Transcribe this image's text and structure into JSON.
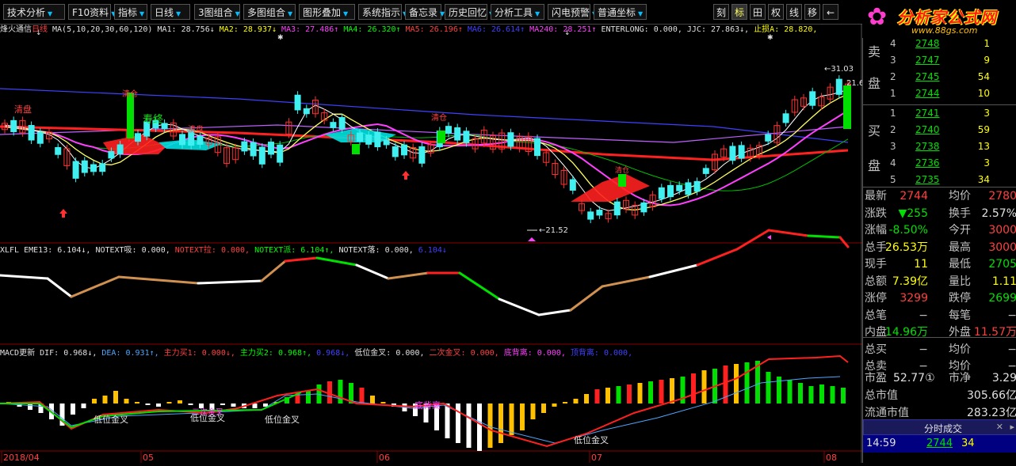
{
  "toolbar": {
    "items": [
      "技术分析",
      "F10资料",
      "指标",
      "日线",
      "3图组合",
      "多图组合",
      "图形叠加",
      "系统指示",
      "备忘录",
      "历史回忆",
      "分析工具",
      "闪电预警",
      "普通坐标"
    ],
    "right": [
      "刻",
      "标",
      "田",
      "权",
      "线",
      "移",
      "←"
    ],
    "dropdown_icon": "triangle-down-icon"
  },
  "logo": {
    "title": "分析家公式网",
    "url": "www.88gs.com",
    "icon": "flower-icon"
  },
  "main_panel": {
    "name": "烽火通信",
    "period": "日线",
    "ma_label": "MA(5,10,20,30,60,120)",
    "items": [
      {
        "k": "MA1:",
        "v": "28.756↓",
        "color": "#e0e0e0"
      },
      {
        "k": "MA2:",
        "v": "28.937↓",
        "color": "#ffff00"
      },
      {
        "k": "MA3:",
        "v": "27.486↑",
        "color": "#ff40ff"
      },
      {
        "k": "MA4:",
        "v": "26.320↑",
        "color": "#00ff00"
      },
      {
        "k": "MA5:",
        "v": "26.196↑",
        "color": "#ff4040"
      },
      {
        "k": "MA6:",
        "v": "26.614↑",
        "color": "#4040ff"
      },
      {
        "k": "MA240:",
        "v": "28.251↑",
        "color": "#ff40ff"
      },
      {
        "k": "ENTERLONG:",
        "v": "0.000,",
        "color": "#e0e0e0"
      },
      {
        "k": "JJC:",
        "v": "27.863↓,",
        "color": "#e0e0e0"
      },
      {
        "k": "止损A:",
        "v": "28.820,",
        "color": "#ffff00"
      }
    ],
    "annotations": {
      "qingpan1": "清盘",
      "qingpan2": "清盘",
      "shouzhong": "寿终",
      "qingcang1": "清仓",
      "qingcang2": "清仓",
      "qingcang3": "清仓",
      "low": "21.52",
      "high": "31.03",
      "last": "21.6"
    }
  },
  "xlfl_panel": {
    "label": "XLFL EME13:",
    "items": [
      {
        "k": "EME13:",
        "v": "6.104↓,",
        "color": "#e0e0e0"
      },
      {
        "k": "NOTEXT吸:",
        "v": "0.000,",
        "color": "#e0e0e0"
      },
      {
        "k": "NOTEXT拉:",
        "v": "0.000,",
        "color": "#ff4040"
      },
      {
        "k": "NOTEXT派:",
        "v": "6.104↑,",
        "color": "#00ff00"
      },
      {
        "k": "NOTEXT落:",
        "v": "0.000,",
        "color": "#e0e0e0"
      },
      {
        "k": "",
        "v": "6.104↓",
        "color": "#4040ff"
      }
    ]
  },
  "macd_panel": {
    "label": "MACD更新",
    "items": [
      {
        "k": "DIF:",
        "v": "0.968↓,",
        "color": "#e0e0e0"
      },
      {
        "k": "DEA:",
        "v": "0.931↑,",
        "color": "#4da6ff"
      },
      {
        "k": "主力买1:",
        "v": "0.000↓,",
        "color": "#ff4040"
      },
      {
        "k": "主力买2:",
        "v": "0.968↑,",
        "color": "#00ff00"
      },
      {
        "k": "",
        "v": "0.968↓,",
        "color": "#4040ff"
      },
      {
        "k": "低位金叉:",
        "v": "0.000,",
        "color": "#e0e0e0"
      },
      {
        "k": "二次金叉:",
        "v": "0.000,",
        "color": "#ff4040"
      },
      {
        "k": "底背离:",
        "v": "0.000,",
        "color": "#ff40ff"
      },
      {
        "k": "顶背离:",
        "v": "0.000,",
        "color": "#4040ff"
      }
    ],
    "annotations": {
      "jx1": "低位金叉",
      "jx2": "低位金叉",
      "jx3": "低位金叉",
      "jx4": "低位金叉",
      "ecjx": "二次金叉",
      "dbl": "底背离"
    }
  },
  "xaxis": {
    "labels": [
      "2018/04",
      "05",
      "06",
      "07",
      "08"
    ]
  },
  "orderbook": {
    "sell_label": [
      "卖",
      "盘"
    ],
    "buy_label": [
      "买",
      "盘"
    ],
    "sells": [
      {
        "lvl": "4",
        "price": "2748",
        "vol": "1"
      },
      {
        "lvl": "3",
        "price": "2747",
        "vol": "9"
      },
      {
        "lvl": "2",
        "price": "2745",
        "vol": "54"
      },
      {
        "lvl": "1",
        "price": "2744",
        "vol": "10"
      }
    ],
    "buys": [
      {
        "lvl": "1",
        "price": "2741",
        "vol": "3"
      },
      {
        "lvl": "2",
        "price": "2740",
        "vol": "59"
      },
      {
        "lvl": "3",
        "price": "2738",
        "vol": "13"
      },
      {
        "lvl": "4",
        "price": "2736",
        "vol": "3"
      },
      {
        "lvl": "5",
        "price": "2735",
        "vol": "34"
      }
    ]
  },
  "quote": [
    {
      "l": "最新",
      "lv": "2744",
      "lc": "#ff4040",
      "r": "均价",
      "rv": "2780",
      "rc": "#ff4040"
    },
    {
      "l": "涨跌",
      "lv": "▼255",
      "lc": "#00e000",
      "r": "换手",
      "rv": "2.57%",
      "rc": "#e0e0e0"
    },
    {
      "l": "涨幅",
      "lv": "-8.50%",
      "lc": "#00e000",
      "r": "今开",
      "rv": "3000",
      "rc": "#ff4040"
    },
    {
      "l": "总手",
      "lv": "26.53万",
      "lc": "#ffff00",
      "r": "最高",
      "rv": "3000",
      "rc": "#ff4040"
    },
    {
      "l": "现手",
      "lv": "11",
      "lc": "#ffff00",
      "r": "最低",
      "rv": "2705",
      "rc": "#00e000"
    },
    {
      "l": "总额",
      "lv": "7.39亿",
      "lc": "#ffff00",
      "r": "量比",
      "rv": "1.11",
      "rc": "#ffff00"
    },
    {
      "l": "涨停",
      "lv": "3299",
      "lc": "#ff4040",
      "r": "跌停",
      "rv": "2699",
      "rc": "#00e000"
    },
    {
      "l": "总笔",
      "lv": "−",
      "lc": "#c0c0c0",
      "r": "每笔",
      "rv": "−",
      "rc": "#c0c0c0"
    },
    {
      "l": "内盘",
      "lv": "14.96万",
      "lc": "#00e000",
      "r": "外盘",
      "rv": "11.57万",
      "rc": "#ff4040"
    },
    {
      "l": "总买",
      "lv": "−",
      "lc": "#c0c0c0",
      "r": "均价",
      "rv": "−",
      "rc": "#c0c0c0"
    },
    {
      "l": "总卖",
      "lv": "−",
      "lc": "#c0c0c0",
      "r": "均价",
      "rv": "−",
      "rc": "#c0c0c0"
    }
  ],
  "fundamentals": [
    {
      "l": "市盈",
      "lv": "52.77①",
      "r": "市净",
      "rv": "3.29"
    },
    {
      "l": "总市值",
      "v": "305.66亿"
    },
    {
      "l": "流通市值",
      "v": "283.23亿"
    }
  ],
  "ticks": {
    "tab": "分时成交",
    "time": "14:59",
    "price": "2744",
    "vol": "34"
  }
}
